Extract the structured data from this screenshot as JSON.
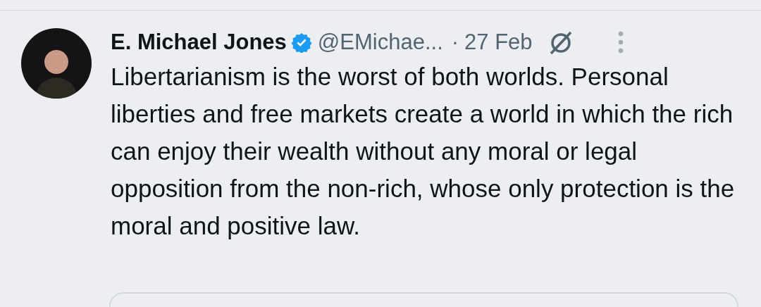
{
  "tweet": {
    "author": {
      "name": "E. Michael Jones",
      "verified": true,
      "handle": "@EMichae...",
      "separator": "·",
      "time": "27 Feb"
    },
    "text": "Libertarianism is the worst of both worlds. Personal liberties and free markets create a world in which the rich can enjoy their wealth without any moral or legal opposition from the non-rich, whose only protection is the moral and positive law."
  }
}
